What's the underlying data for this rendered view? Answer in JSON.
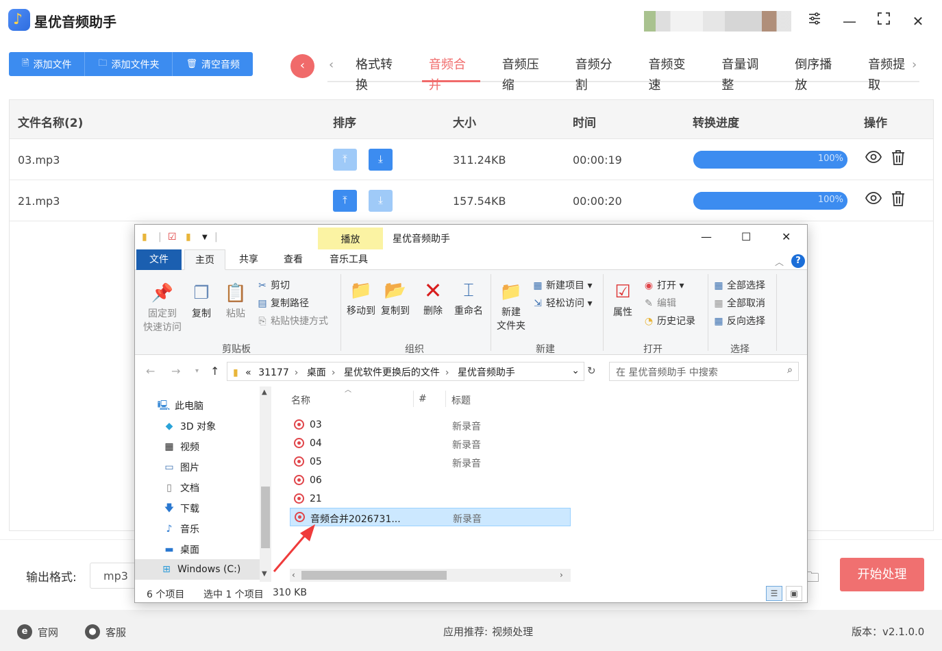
{
  "app": {
    "title": "星优音频助手",
    "window_controls": [
      "settings-icon",
      "minimize-icon",
      "maximize-icon",
      "close-icon"
    ]
  },
  "toolbar": {
    "add_file": "添加文件",
    "add_folder": "添加文件夹",
    "clear": "清空音频"
  },
  "tabs": [
    "格式转换",
    "音频合并",
    "音频压缩",
    "音频分割",
    "音频变速",
    "音量调整",
    "倒序播放",
    "音频提取"
  ],
  "active_tab": "音频合并",
  "table": {
    "headers": {
      "name": "文件名称(2)",
      "order": "排序",
      "size": "大小",
      "time": "时间",
      "progress": "转换进度",
      "ops": "操作"
    },
    "rows": [
      {
        "name": "03.mp3",
        "size": "311.24KB",
        "time": "00:00:19",
        "progress": 100,
        "progress_label": "100%"
      },
      {
        "name": "21.mp3",
        "size": "157.54KB",
        "time": "00:00:20",
        "progress": 100,
        "progress_label": "100%"
      }
    ]
  },
  "bottom": {
    "output_label": "输出格式:",
    "format": "mp3",
    "start": "开始处理"
  },
  "footer": {
    "site": "官网",
    "service": "客服",
    "recommend_label": "应用推荐:",
    "recommend_item": "视频处理",
    "version": "版本：v2.1.0.0"
  },
  "explorer": {
    "title": "星优音频助手",
    "play_tab": "播放",
    "ribbon_tabs": {
      "file": "文件",
      "home": "主页",
      "share": "共享",
      "view": "查看",
      "music_tools": "音乐工具"
    },
    "clipboard": {
      "pin": "固定到",
      "pin2": "快速访问",
      "copy": "复制",
      "paste": "粘贴",
      "cut": "剪切",
      "copy_path": "复制路径",
      "paste_shortcut": "粘贴快捷方式",
      "label": "剪贴板"
    },
    "organize": {
      "move_to": "移动到",
      "copy_to": "复制到",
      "delete": "删除",
      "rename": "重命名",
      "label": "组织"
    },
    "new": {
      "new_folder": "新建",
      "new_folder2": "文件夹",
      "new_item": "新建项目",
      "easy_access": "轻松访问",
      "label": "新建"
    },
    "open": {
      "properties": "属性",
      "open": "打开",
      "edit": "编辑",
      "history": "历史记录",
      "label": "打开"
    },
    "select": {
      "all": "全部选择",
      "none": "全部取消",
      "invert": "反向选择",
      "label": "选择"
    },
    "address": [
      "31177",
      "桌面",
      "星优软件更换后的文件",
      "星优音频助手"
    ],
    "address_prefix": "«",
    "search_placeholder": "在 星优音频助手 中搜索",
    "nav": [
      "此电脑",
      "3D 对象",
      "视频",
      "图片",
      "文档",
      "下载",
      "音乐",
      "桌面",
      "Windows (C:)"
    ],
    "columns": {
      "name": "名称",
      "num": "#",
      "title": "标题"
    },
    "files": [
      {
        "name": "03",
        "title": "新录音"
      },
      {
        "name": "04",
        "title": "新录音"
      },
      {
        "name": "05",
        "title": "新录音"
      },
      {
        "name": "06",
        "title": ""
      },
      {
        "name": "21",
        "title": ""
      },
      {
        "name": "音频合并2026731...",
        "title": "新录音"
      }
    ],
    "status": {
      "count": "6 个项目",
      "selected": "选中 1 个项目",
      "size": "310 KB"
    }
  },
  "colors": {
    "accent_blue": "#3c8cf0",
    "accent_red": "#f06a6a",
    "light_blue": "#9fcaf8",
    "selection": "#cce8ff"
  }
}
